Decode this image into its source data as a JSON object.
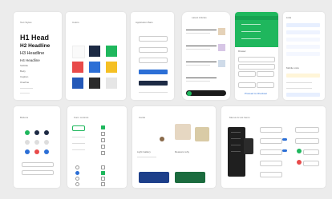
{
  "cards": {
    "typography": {
      "title": "Text Styles",
      "h1": "H1 Head",
      "h2": "H2 Headline",
      "h3": "H3 Headline",
      "h4": "H4 Headline",
      "sub1": "Subtitle",
      "sub2": "Body",
      "sub3": "Caption",
      "sub4": "Overline"
    },
    "colors": {
      "title": "Colors",
      "label_a": "Primary",
      "label_b": "Secondary"
    },
    "appbar": {
      "title": "Application Bars"
    },
    "phone_list": {
      "title": "Latest Articles"
    },
    "green_menu": {
      "title": "Drawer",
      "footer": "Proceed to Checkout"
    },
    "right_list": {
      "title": "Lists",
      "section": "Mobile Lists"
    },
    "buttons": {
      "title": "Buttons"
    },
    "forms": {
      "title": "Form controls"
    },
    "cards_sec": {
      "title": "Cards",
      "sub1": "Light Gallery",
      "sub2": "Reasons why"
    },
    "menus": {
      "title": "Menus & List Items"
    }
  },
  "colors": {
    "primary": "#1fb75d",
    "navy": "#1d2a44",
    "blue": "#2c6fd6",
    "red": "#e84a4a",
    "yellow": "#f5c024",
    "grey": "#e6e6e6"
  },
  "icons": [
    "avatar-icon",
    "check-icon",
    "radio-icon",
    "menu-icon"
  ]
}
